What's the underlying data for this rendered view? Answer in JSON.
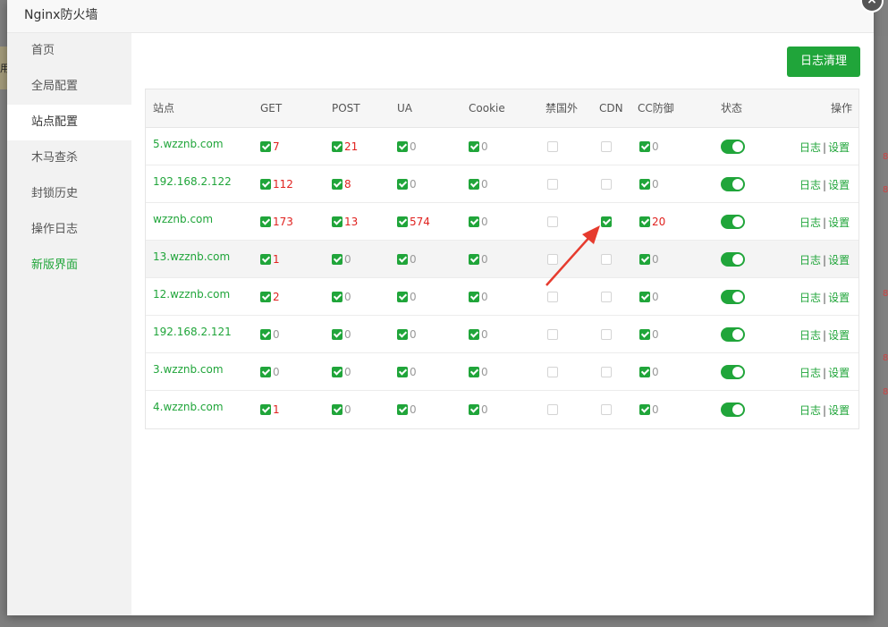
{
  "dialog": {
    "title": "Nginx防火墙",
    "close_icon": "×"
  },
  "background": {
    "left_char": "用"
  },
  "sidebar": {
    "items": [
      {
        "label": "首页"
      },
      {
        "label": "全局配置"
      },
      {
        "label": "站点配置"
      },
      {
        "label": "木马查杀"
      },
      {
        "label": "封锁历史"
      },
      {
        "label": "操作日志"
      },
      {
        "label": "新版界面"
      }
    ],
    "active_index": 2
  },
  "toolbar": {
    "clear_label": "日志清理"
  },
  "table": {
    "headers": {
      "site": "站点",
      "get": "GET",
      "post": "POST",
      "ua": "UA",
      "cookie": "Cookie",
      "foreign": "禁国外",
      "cdn": "CDN",
      "cc": "CC防御",
      "status": "状态",
      "ops": "操作"
    },
    "ops_log": "日志",
    "ops_sep": "|",
    "ops_settings": "设置",
    "rows": [
      {
        "site": "5.wzznb.com",
        "get": "7",
        "post": "21",
        "ua": "0",
        "cookie": "0",
        "cdn": false,
        "cc": "0"
      },
      {
        "site": "192.168.2.122",
        "get": "112",
        "post": "8",
        "ua": "0",
        "cookie": "0",
        "cdn": false,
        "cc": "0"
      },
      {
        "site": "wzznb.com",
        "get": "173",
        "post": "13",
        "ua": "574",
        "cookie": "0",
        "cdn": true,
        "cc": "20"
      },
      {
        "site": "13.wzznb.com",
        "get": "1",
        "post": "0",
        "ua": "0",
        "cookie": "0",
        "cdn": false,
        "cc": "0"
      },
      {
        "site": "12.wzznb.com",
        "get": "2",
        "post": "0",
        "ua": "0",
        "cookie": "0",
        "cdn": false,
        "cc": "0"
      },
      {
        "site": "192.168.2.121",
        "get": "0",
        "post": "0",
        "ua": "0",
        "cookie": "0",
        "cdn": false,
        "cc": "0"
      },
      {
        "site": "3.wzznb.com",
        "get": "0",
        "post": "0",
        "ua": "0",
        "cookie": "0",
        "cdn": false,
        "cc": "0"
      },
      {
        "site": "4.wzznb.com",
        "get": "1",
        "post": "0",
        "ua": "0",
        "cookie": "0",
        "cdn": false,
        "cc": "0"
      }
    ]
  },
  "colors": {
    "accent": "#20a53a",
    "alert_red": "#e0221f",
    "arrow": "#e63b2e"
  }
}
